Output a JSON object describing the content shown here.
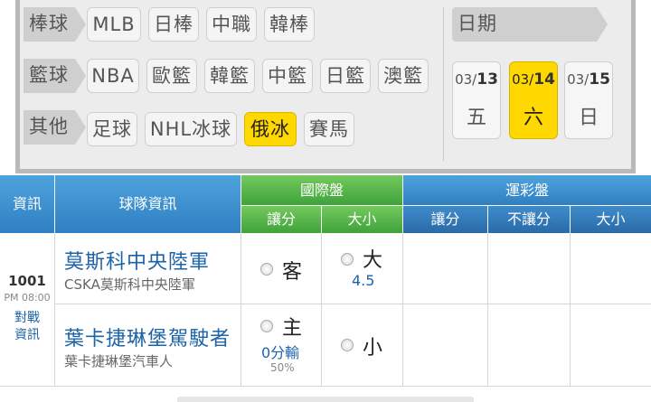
{
  "categories": {
    "baseball": {
      "label": "棒球",
      "items": [
        "MLB",
        "日棒",
        "中職",
        "韓棒"
      ]
    },
    "basketball": {
      "label": "籃球",
      "items": [
        "NBA",
        "歐籃",
        "韓籃",
        "中籃",
        "日籃",
        "澳籃"
      ]
    },
    "other": {
      "label": "其他",
      "items": [
        "足球",
        "NHL冰球",
        "俄冰",
        "賽馬"
      ],
      "active": "俄冰"
    }
  },
  "date": {
    "label": "日期",
    "days": [
      {
        "month": "03/",
        "day": "13",
        "weekday": "五",
        "active": false
      },
      {
        "month": "03/",
        "day": "14",
        "weekday": "六",
        "active": true
      },
      {
        "month": "03/",
        "day": "15",
        "weekday": "日",
        "active": false
      }
    ]
  },
  "table": {
    "col_info": "資訊",
    "col_team": "球隊資訊",
    "intl": {
      "title": "國際盤",
      "handicap": "讓分",
      "over_under": "大小"
    },
    "sports_lottery": {
      "title": "運彩盤",
      "handicap": "讓分",
      "no_handicap": "不讓分",
      "over_under": "大小"
    },
    "colors": {
      "blue": "#2f7fc2",
      "green": "#3ea33a",
      "active_yellow": "#ffd800"
    }
  },
  "match": {
    "number": "1001",
    "time": "PM 08:00",
    "info_link": [
      "對戰",
      "資訊"
    ],
    "away": {
      "name": "莫斯科中央陸軍",
      "sub": "CSKA莫斯科中央陸軍",
      "side": "客",
      "ou": "大",
      "ou_line": "4.5"
    },
    "home": {
      "name": "葉卡捷琳堡駕駛者",
      "sub": "葉卡捷琳堡汽車人",
      "side": "主",
      "handicap": "0分輸",
      "percent": "50%",
      "ou": "小"
    }
  }
}
